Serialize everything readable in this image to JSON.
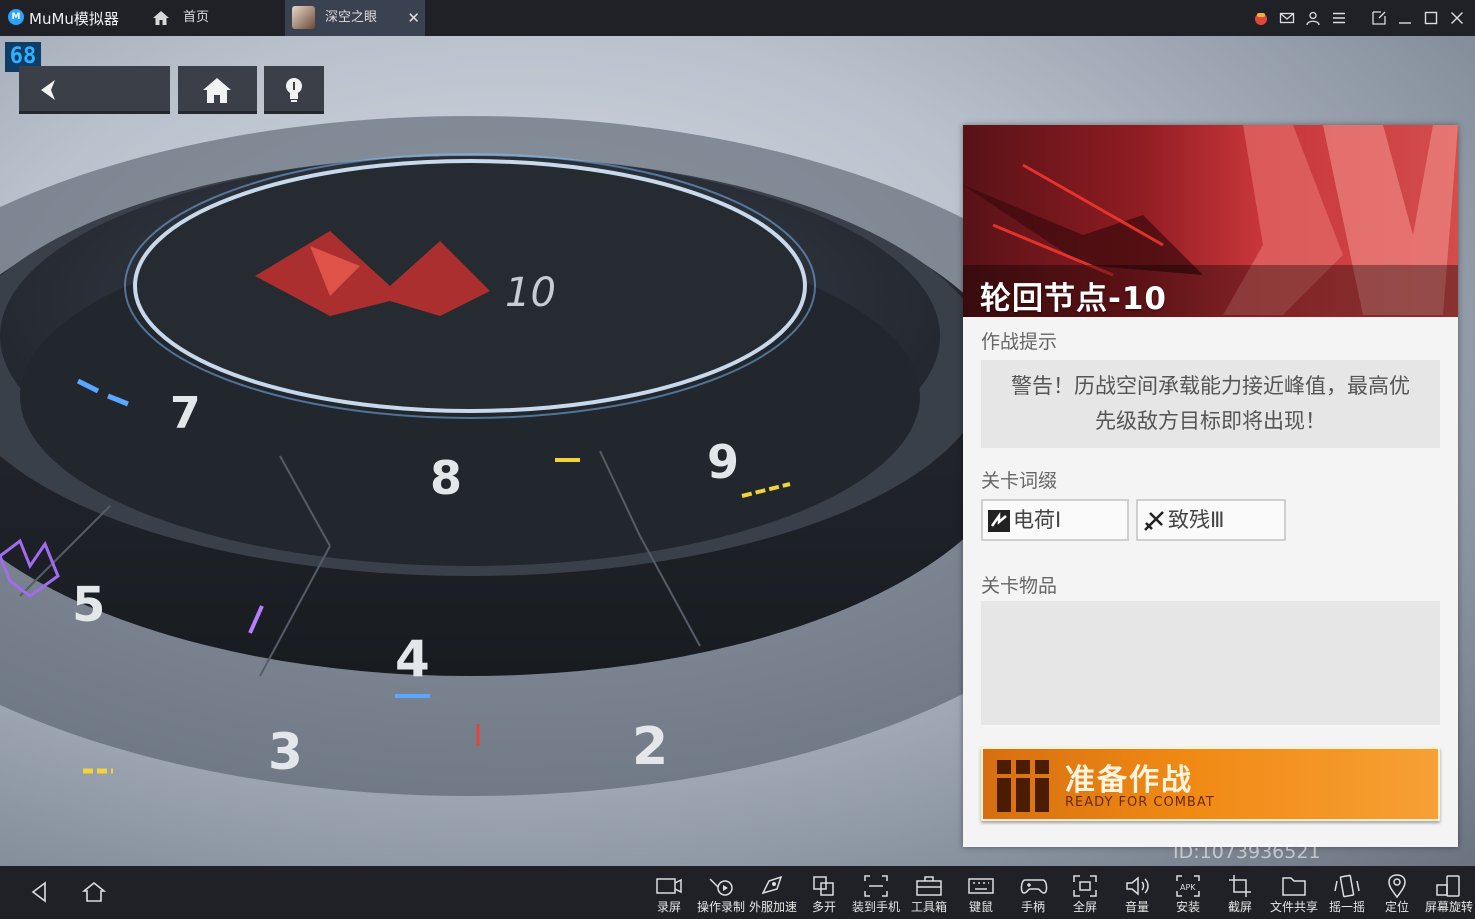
{
  "titlebar": {
    "app_name": "MuMu模拟器",
    "logo_text": "M",
    "tabs": [
      {
        "label": "首页"
      },
      {
        "label": "深空之眼"
      }
    ],
    "close_glyph": "✕"
  },
  "game": {
    "fps": "68",
    "stage_numbers": [
      "10",
      "9",
      "8",
      "7",
      "5",
      "4",
      "3",
      "2"
    ],
    "panel": {
      "title": "轮回节点-10",
      "hint_label": "作战提示",
      "hint_lines": [
        "警告！历战空间承载能力接近峰值，最高优",
        "先级敌方目标即将出现！"
      ],
      "affix_label": "关卡词缀",
      "affixes": [
        {
          "label": "电荷Ⅰ",
          "icon": "charge-icon"
        },
        {
          "label": "致残Ⅲ",
          "icon": "cripple-icon"
        }
      ],
      "items_label": "关卡物品",
      "ready_main": "准备作战",
      "ready_sub": "READY FOR COMBAT"
    },
    "watermark": "ID:1073936521"
  },
  "toolbar": {
    "tools": [
      {
        "label": "录屏",
        "icon": "record-screen-icon"
      },
      {
        "label": "操作录制",
        "icon": "macro-record-icon"
      },
      {
        "label": "外服加速",
        "icon": "accelerate-icon"
      },
      {
        "label": "多开",
        "icon": "multi-instance-icon"
      },
      {
        "label": "装到手机",
        "icon": "install-to-phone-icon"
      },
      {
        "label": "工具箱",
        "icon": "toolbox-icon"
      },
      {
        "label": "键鼠",
        "icon": "keyboard-icon"
      },
      {
        "label": "手柄",
        "icon": "gamepad-icon"
      },
      {
        "label": "全屏",
        "icon": "fullscreen-icon"
      },
      {
        "label": "音量",
        "icon": "volume-icon"
      },
      {
        "label": "安装",
        "icon": "apk-install-icon"
      },
      {
        "label": "截屏",
        "icon": "screenshot-icon"
      },
      {
        "label": "文件共享",
        "icon": "folder-icon"
      },
      {
        "label": "摇一摇",
        "icon": "shake-icon"
      },
      {
        "label": "定位",
        "icon": "location-icon"
      },
      {
        "label": "屏幕旋转",
        "icon": "rotate-icon"
      }
    ]
  },
  "colors": {
    "accent_blue": "#2aa3ff",
    "banner_red": "#c83639",
    "ready_orange": "#f08a14"
  }
}
